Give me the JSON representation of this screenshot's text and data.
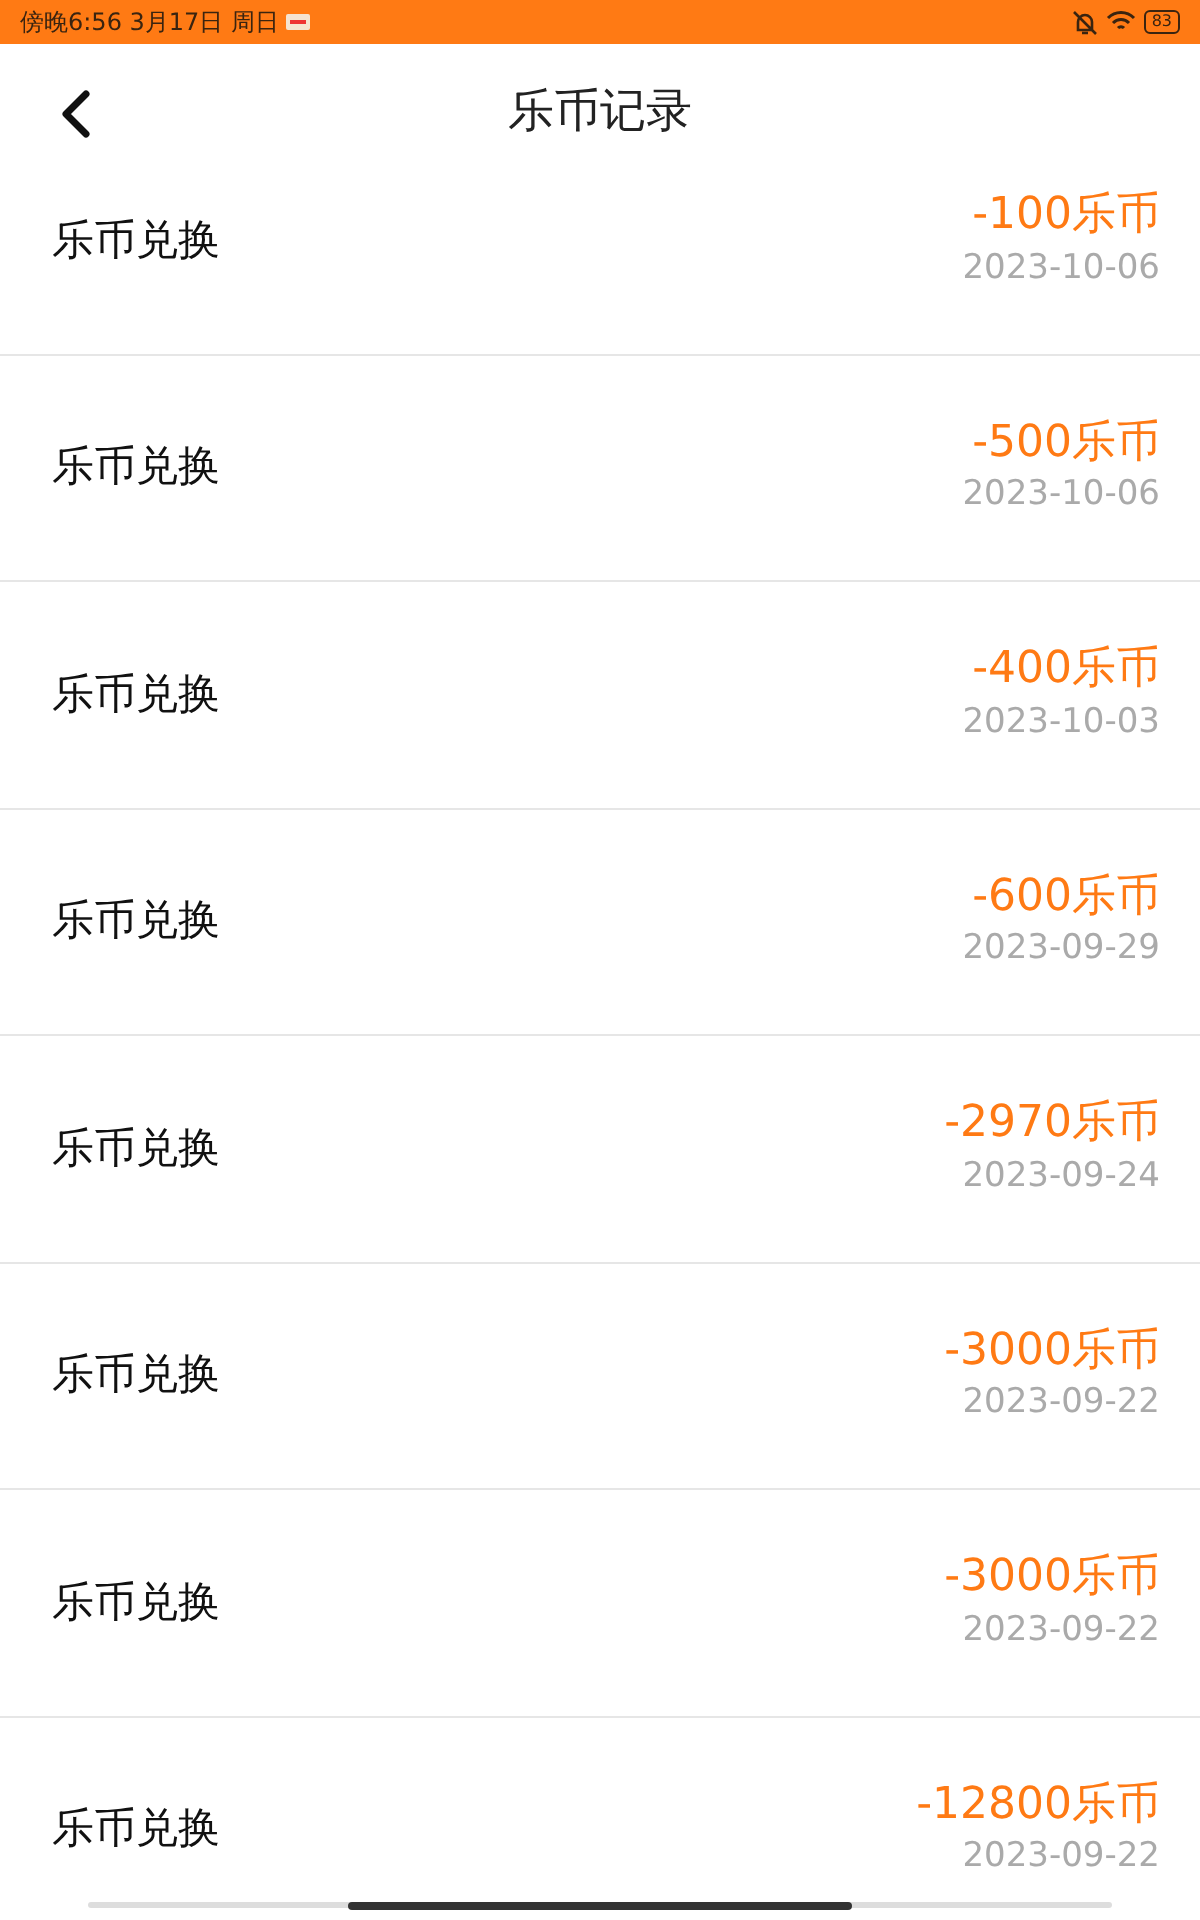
{
  "status_bar": {
    "time": "傍晚6:56 3月17日 周日",
    "battery": "83"
  },
  "header": {
    "title": "乐币记录"
  },
  "records": [
    {
      "label": "乐币兑换",
      "amount": "-100乐币",
      "date": "2023-10-06"
    },
    {
      "label": "乐币兑换",
      "amount": "-500乐币",
      "date": "2023-10-06"
    },
    {
      "label": "乐币兑换",
      "amount": "-400乐币",
      "date": "2023-10-03"
    },
    {
      "label": "乐币兑换",
      "amount": "-600乐币",
      "date": "2023-09-29"
    },
    {
      "label": "乐币兑换",
      "amount": "-2970乐币",
      "date": "2023-09-24"
    },
    {
      "label": "乐币兑换",
      "amount": "-3000乐币",
      "date": "2023-09-22"
    },
    {
      "label": "乐币兑换",
      "amount": "-3000乐币",
      "date": "2023-09-22"
    },
    {
      "label": "乐币兑换",
      "amount": "-12800乐币",
      "date": "2023-09-22"
    }
  ]
}
